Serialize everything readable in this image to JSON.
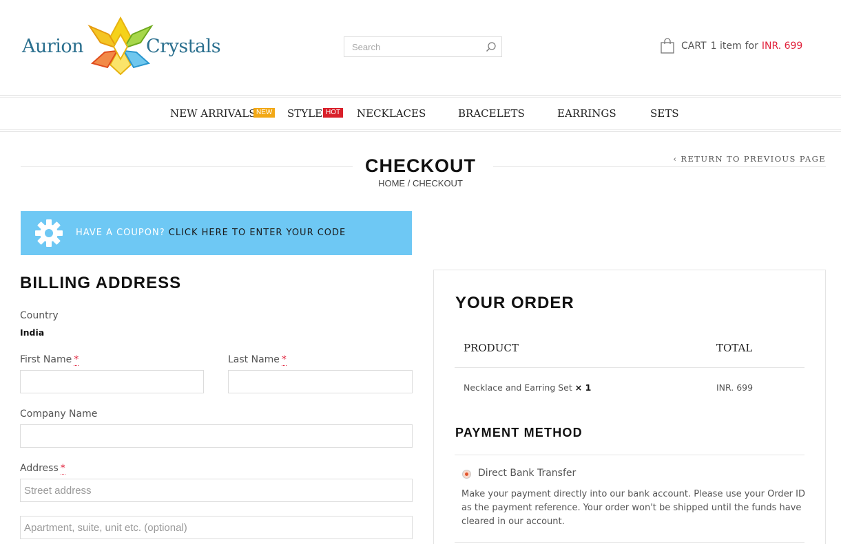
{
  "header": {
    "logo": {
      "text_left": "Aurion",
      "text_right": "Crystals"
    },
    "search": {
      "placeholder": "Search"
    },
    "cart": {
      "label": "CART",
      "count": "1 item",
      "for": "for",
      "price": "INR. 699"
    }
  },
  "nav": {
    "items": [
      {
        "label": "NEW ARRIVALS",
        "badge": "NEW"
      },
      {
        "label": "STYLE",
        "badge": "HOT"
      },
      {
        "label": "NECKLACES"
      },
      {
        "label": "BRACELETS"
      },
      {
        "label": "EARRINGS"
      },
      {
        "label": "SETS"
      }
    ]
  },
  "page": {
    "title": "CHECKOUT",
    "breadcrumb": {
      "home": "HOME",
      "separator": " / ",
      "current": "CHECKOUT"
    },
    "return_link": "RETURN TO PREVIOUS PAGE"
  },
  "coupon": {
    "prompt": "HAVE A COUPON?",
    "link": "CLICK HERE TO ENTER YOUR CODE"
  },
  "billing": {
    "title": "BILLING ADDRESS",
    "country_label": "Country",
    "country_value": "India",
    "first_name_label": "First Name",
    "last_name_label": "Last Name",
    "company_label": "Company Name",
    "address_label": "Address",
    "required_mark": "*",
    "street_placeholder": "Street address",
    "apartment_placeholder": "Apartment, suite, unit etc. (optional)"
  },
  "order": {
    "title": "YOUR ORDER",
    "product_header": "PRODUCT",
    "total_header": "TOTAL",
    "item_name": "Necklace and Earring Set",
    "item_qty": "× 1",
    "item_total": "INR. 699",
    "payment_title": "PAYMENT METHOD",
    "payment_option": "Direct Bank Transfer",
    "payment_desc": "Make your payment directly into our bank account. Please use your Order ID as the payment reference. Your order won't be shipped until the funds have cleared in our account."
  },
  "colors": {
    "accent_red": "#e0203a",
    "coupon_bg": "#6ec8f4",
    "badge_new": "#f2a816",
    "badge_hot": "#d9202a"
  },
  "icons": [
    "search-icon",
    "cart-bag-icon",
    "gear-icon",
    "chevron-left-icon",
    "radio-selected-icon"
  ]
}
